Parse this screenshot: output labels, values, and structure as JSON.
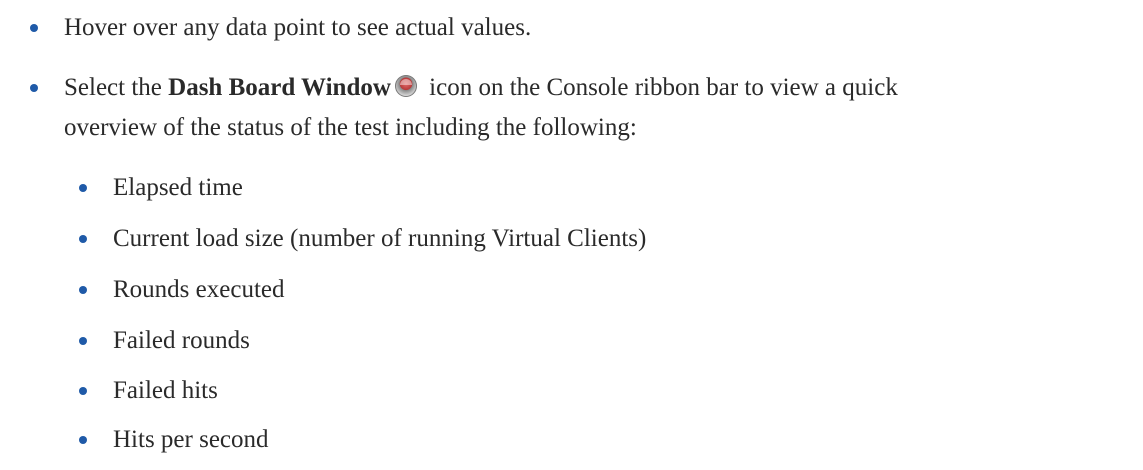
{
  "bullets": [
    {
      "text": "Hover over any data point to see actual values."
    },
    {
      "prefix": "Select the ",
      "bold": "Dash Board Window",
      "icon": "dashboard-gauge-icon",
      "line1_rest": " icon on the Console ribbon bar to view a quick",
      "line2": "overview of the status of the test including the following:"
    }
  ],
  "sub_bullets": [
    "Elapsed time",
    "Current load size (number of running Virtual Clients)",
    "Rounds executed",
    "Failed rounds",
    "Failed hits",
    "Hits per second"
  ],
  "colors": {
    "bullet": "#1f5aa8",
    "text": "#2a2a2a"
  }
}
